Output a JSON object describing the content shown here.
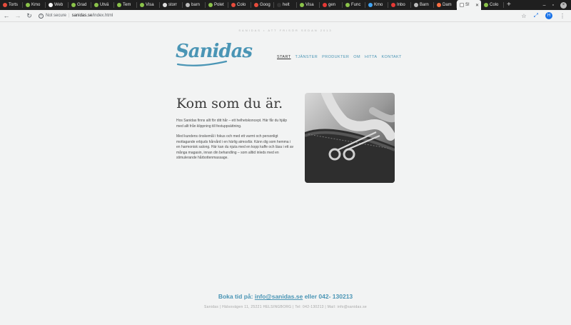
{
  "browser": {
    "tabs": [
      {
        "label": "Torts",
        "color": "#e74c3c"
      },
      {
        "label": "Kmo",
        "color": "#8bc34a"
      },
      {
        "label": "Web",
        "color": "#ffffff"
      },
      {
        "label": "Grad",
        "color": "#8bc34a"
      },
      {
        "label": "Utvä",
        "color": "#8bc34a"
      },
      {
        "label": "Tem",
        "color": "#8bc34a"
      },
      {
        "label": "Visa",
        "color": "#8bc34a"
      },
      {
        "label": "storr",
        "color": "#dddddd"
      },
      {
        "label": "barn",
        "color": "#bbbbbb"
      },
      {
        "label": "Polet",
        "color": "#8bc34a"
      },
      {
        "label": "Colo",
        "color": "#e74c3c"
      },
      {
        "label": "Goog",
        "color": "#e74c3c"
      },
      {
        "label": "helt",
        "color": "#333333"
      },
      {
        "label": "Visa",
        "color": "#8bc34a"
      },
      {
        "label": "gen",
        "color": "#e53935"
      },
      {
        "label": "Func",
        "color": "#8bc34a"
      },
      {
        "label": "Kmo",
        "color": "#42a5f5"
      },
      {
        "label": "Inbo",
        "color": "#e53935"
      },
      {
        "label": "Barn",
        "color": "#bbbbbb"
      },
      {
        "label": "Dam",
        "color": "#ff7043"
      }
    ],
    "active_tab": {
      "label": "S!"
    },
    "last_tab": {
      "label": "Colo",
      "color": "#8bc34a"
    },
    "new_tab": "+",
    "window_controls": {
      "minimize": "–",
      "maximize": "▫",
      "close": "×"
    },
    "address": {
      "security": "Not secure",
      "host": "sanidas.se",
      "path": "/index.html"
    },
    "profile_initial": "H"
  },
  "site": {
    "tagline": "SANIDAS • ATT FRISÖR SEDAN 2013",
    "logo": "Sanidas",
    "nav": [
      "START",
      "TJÄNSTER",
      "PRODUKTER",
      "OM",
      "HITTA",
      "KONTAKT"
    ],
    "headline": "Kom som du är.",
    "paragraph1_line1": "Hos Sanidas finns allt för ditt hår – ett helhetskoncept. Här får du hjälp",
    "paragraph1_line2": "med allt från klippning till festuppsättning.",
    "paragraph2": [
      "Med kundens önskemål i fokus och med ett varmt och personligt",
      "mottagande erbjuds hårvård i en härlig atmosfär. Känn dig som hemma i",
      "en harmonisk salong. Här kan du njuta med en kopp kaffe och läsa i ett av",
      "många magasin, innan din behandling – som alltid inleds med en",
      "stimulerande hårbottenmassage."
    ],
    "booking_prefix": "Boka tid på:",
    "booking_email": "info@sanidas.se",
    "booking_suffix": "eller 042- 130213",
    "footer": "Sanidas | Hälsovägen 11, 25221 HELSINGBORG | Tel: 042-130213 | Mail: info@sanidas.se"
  },
  "colors": {
    "accent": "#4a95b5",
    "page_bg": "#f2f3f3",
    "tabstrip_bg": "#1f1f1f"
  }
}
